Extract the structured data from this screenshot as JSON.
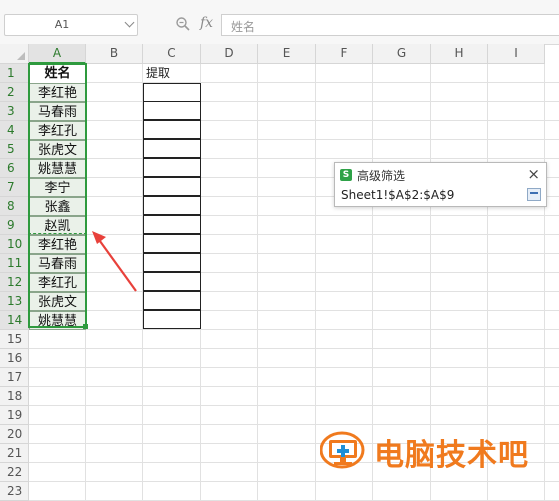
{
  "formula_bar": {
    "name_box": "A1",
    "fx_label": "fx",
    "formula_value": "姓名"
  },
  "columns": [
    "A",
    "B",
    "C",
    "D",
    "E",
    "F",
    "G",
    "H",
    "I"
  ],
  "rows": [
    "1",
    "2",
    "3",
    "4",
    "5",
    "6",
    "7",
    "8",
    "9",
    "10",
    "11",
    "12",
    "13",
    "14",
    "15",
    "16",
    "17",
    "18",
    "19",
    "20",
    "21",
    "22",
    "23"
  ],
  "column_a": [
    "姓名",
    "李红艳",
    "马春雨",
    "李红孔",
    "张虎文",
    "姚慧慧",
    "李宁",
    "张鑫",
    "赵凯",
    "李红艳",
    "马春雨",
    "李红孔",
    "张虎文",
    "姚慧慧"
  ],
  "column_c_header": "提取",
  "dialog": {
    "icon_letter": "S",
    "title": "高级筛选",
    "close": "×",
    "range_value": "Sheet1!$A$2:$A$9"
  },
  "watermark": {
    "text": "电脑技术吧",
    "color": "#f07a1e"
  },
  "colors": {
    "selection_green": "#2e9a3e",
    "arrow_red": "#e8413b",
    "cell_fill": "#eaf1e9"
  }
}
